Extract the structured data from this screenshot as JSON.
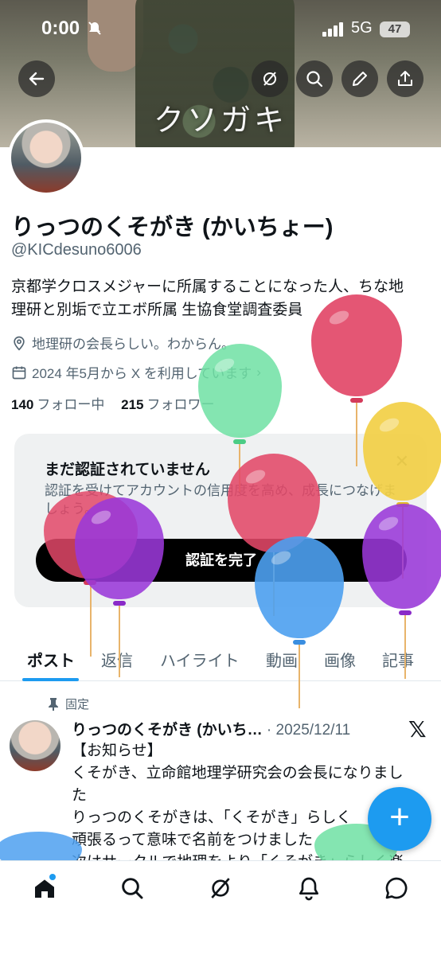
{
  "status_bar": {
    "time": "0:00",
    "network": "5G",
    "battery": "47"
  },
  "banner": {
    "text": "クソガキ"
  },
  "header_buttons": [
    "back-icon",
    "grok-icon",
    "search-icon",
    "edit-icon",
    "share-icon"
  ],
  "profile": {
    "name": "りっつのくそがき (かいちょー)",
    "handle": "@KICdesuno6006",
    "bio_line1": "京都学クロスメジャーに所属することになった人、ちな地",
    "bio_line2": "理研と別垢で立エボ所属 生協食堂調査委員",
    "location": "地理研の会長らしい。わからん。",
    "joined": "2024 年5月から X を利用しています",
    "following_count": "140",
    "following_label": "フォロー中",
    "followers_count": "215",
    "followers_label": "フォロワー"
  },
  "verify_card": {
    "title": "まだ認証されていません",
    "description": "認証を受けてアカウントの信用度を高め、成長につなげましょう。",
    "button": "認証を完了"
  },
  "tabs": [
    "ポスト",
    "返信",
    "ハイライト",
    "動画",
    "画像",
    "記事"
  ],
  "post": {
    "pinned_label": "固定",
    "author": "りっつのくそがき (かいち…",
    "date": "· 2025/12/11",
    "line1": "【お知らせ】",
    "line2": "くそがき、立命館地理学研究会の会長になりまし",
    "line3": "た",
    "line4": "りっつのくそがきは、「くそがき」らしく",
    "line5": "頑張るって意味で名前をつけました",
    "line6": "次はサークルで地理をより「くそがき」らしく楽"
  },
  "fab_label": "+",
  "nav": [
    "home-icon",
    "search-icon",
    "grok-icon",
    "notifications-icon",
    "messages-icon"
  ]
}
